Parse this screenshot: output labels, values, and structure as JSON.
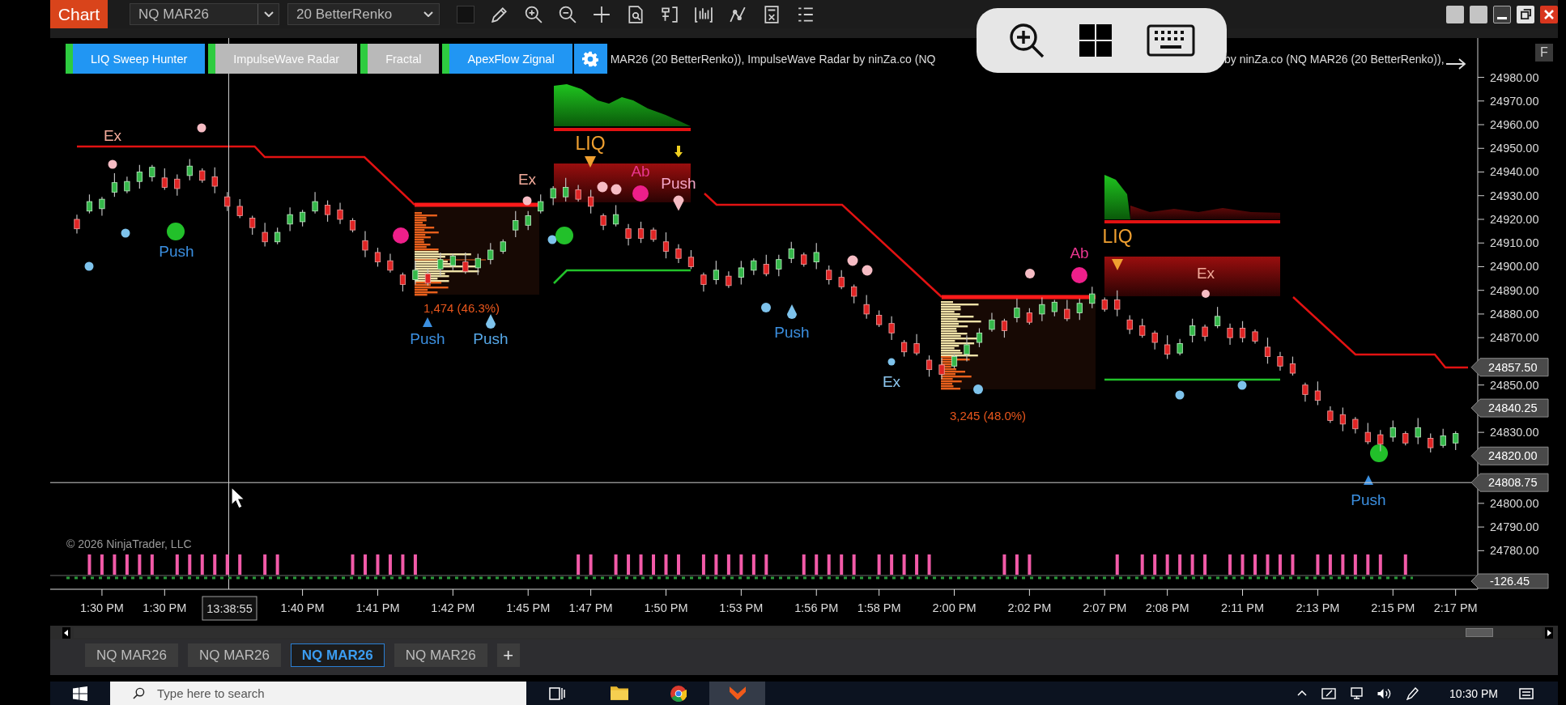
{
  "toolbar": {
    "title": "Chart",
    "instrument": "NQ MAR26",
    "interval": "20 BetterRenko"
  },
  "indicator_buttons": [
    {
      "label": "LIQ Sweep Hunter",
      "enabled": true
    },
    {
      "label": "ImpulseWave Radar",
      "enabled": false
    },
    {
      "label": "Fractal",
      "enabled": false
    },
    {
      "label": "ApexFlow Zignal",
      "enabled": true
    }
  ],
  "indicator_legend": [
    "MAR26 (20 BetterRenko)), ImpulseWave Radar by ninZa.co (NQ",
    "by ninZa.co (NQ MAR26 (20 BetterRenko)),"
  ],
  "side_button": "F",
  "chart": {
    "chart_data": {
      "type": "candlestick",
      "categories": [
        null,
        null,
        "1:30 PM",
        null,
        null,
        null,
        null,
        "1:30 PM",
        null,
        null,
        null,
        null,
        null,
        null,
        null,
        null,
        null,
        null,
        "1:40 PM",
        null,
        null,
        null,
        null,
        null,
        "1:41 PM",
        null,
        null,
        null,
        null,
        null,
        "1:42 PM",
        null,
        null,
        null,
        null,
        null,
        "1:45 PM",
        null,
        null,
        null,
        null,
        "1:47 PM",
        null,
        null,
        null,
        null,
        null,
        "1:50 PM",
        null,
        null,
        null,
        null,
        null,
        "1:53 PM",
        null,
        null,
        null,
        null,
        null,
        "1:56 PM",
        null,
        null,
        null,
        null,
        "1:58 PM",
        null,
        null,
        null,
        null,
        null,
        "2:00 PM",
        null,
        null,
        null,
        null,
        null,
        "2:02 PM",
        null,
        null,
        null,
        null,
        null,
        "2:07 PM",
        null,
        null,
        null,
        null,
        "2:08 PM",
        null,
        null,
        null,
        null,
        null,
        "2:11 PM",
        null,
        null,
        null,
        null,
        null,
        "2:13 PM",
        null,
        null,
        null,
        null,
        null,
        "2:15 PM",
        null,
        null,
        null,
        null,
        "2:17 PM"
      ],
      "ohlc": [
        [
          24920,
          24922,
          24914,
          24916
        ],
        [
          24923.5,
          24930.5,
          24922.5,
          24927.5
        ],
        [
          24924.5,
          24929.5,
          24921.5,
          24928.5
        ],
        [
          24931.5,
          24939.5,
          24929.5,
          24935.5
        ],
        [
          24932,
          24938,
          24931,
          24936
        ],
        [
          24936,
          24943,
          24933,
          24940
        ],
        [
          24938,
          24943,
          24936,
          24942
        ],
        [
          24937.5,
          24941.5,
          24932.5,
          24933.5
        ],
        [
          24937,
          24939,
          24930,
          24933
        ],
        [
          24938.5,
          24945.5,
          24936.5,
          24942.5
        ],
        [
          24940.5,
          24941.5,
          24935.5,
          24936.5
        ],
        [
          24938,
          24942,
          24931,
          24934
        ],
        [
          24929.5,
          24931.5,
          24923.5,
          24925.5
        ],
        [
          24925.5,
          24928.5,
          24920.5,
          24921.5
        ],
        [
          24920.5,
          24921.5,
          24913.5,
          24916.5
        ],
        [
          24914.5,
          24918.5,
          24908.5,
          24910.5
        ],
        [
          24910.5,
          24916.5,
          24909.5,
          24914.5
        ],
        [
          24918,
          24925,
          24915,
          24922
        ],
        [
          24919,
          24924,
          24917,
          24923
        ],
        [
          24923.5,
          24931.5,
          24922.5,
          24927.5
        ],
        [
          24926,
          24928,
          24919,
          24922
        ],
        [
          24924,
          24927,
          24918,
          24920
        ],
        [
          24919.5,
          24920.5,
          24914.5,
          24915.5
        ],
        [
          24911,
          24915,
          24904,
          24907
        ],
        [
          24906,
          24908,
          24900,
          24902
        ],
        [
          24902.5,
          24905.5,
          24897.5,
          24898.5
        ],
        [
          24896.5,
          24897.5,
          24889.5,
          24892.5
        ],
        [
          24894.5,
          24902.5,
          24892.5,
          24898.5
        ],
        [
          24897,
          24899,
          24892,
          24893
        ],
        [
          24899,
          24906,
          24896,
          24903
        ],
        [
          24900.5,
          24905.5,
          24898.5,
          24904.5
        ],
        [
          24902,
          24906,
          24897,
          24898
        ],
        [
          24899.5,
          24905.5,
          24896.5,
          24903.5
        ],
        [
          24903,
          24910,
          24901,
          24907
        ],
        [
          24906.5,
          24911.5,
          24905.5,
          24910.5
        ],
        [
          24915.5,
          24923.5,
          24912.5,
          24919.5
        ],
        [
          24917.5,
          24923.5,
          24915.5,
          24921.5
        ],
        [
          24923.5,
          24930.5,
          24922.5,
          24927.5
        ],
        [
          24929,
          24934,
          24926,
          24933
        ],
        [
          24929.5,
          24937.5,
          24927.5,
          24933.5
        ],
        [
          24932.5,
          24934.5,
          24927.5,
          24928.5
        ],
        [
          24929.5,
          24932.5,
          24922.5,
          24925.5
        ],
        [
          24921.5,
          24922.5,
          24915.5,
          24917.5
        ],
        [
          24918,
          24926,
          24917,
          24922
        ],
        [
          24916,
          24918,
          24909,
          24912
        ],
        [
          24916,
          24919,
          24910,
          24912
        ],
        [
          24915.5,
          24916.5,
          24910.5,
          24911.5
        ],
        [
          24910.5,
          24914.5,
          24903.5,
          24906.5
        ],
        [
          24907.5,
          24909.5,
          24901.5,
          24903.5
        ],
        [
          24904,
          24907,
          24899,
          24900
        ],
        [
          24896.5,
          24897.5,
          24889.5,
          24892.5
        ],
        [
          24894.5,
          24902.5,
          24892.5,
          24898.5
        ],
        [
          24896,
          24898,
          24891,
          24892
        ],
        [
          24895.5,
          24902.5,
          24892.5,
          24899.5
        ],
        [
          24898.5,
          24903.5,
          24896.5,
          24902.5
        ],
        [
          24901,
          24905,
          24896,
          24897
        ],
        [
          24899,
          24905,
          24896,
          24903
        ],
        [
          24903.5,
          24910.5,
          24901.5,
          24907.5
        ],
        [
          24905,
          24906,
          24900,
          24901
        ],
        [
          24902,
          24910,
          24899,
          24906
        ],
        [
          24898.5,
          24900.5,
          24892.5,
          24894.5
        ],
        [
          24895.5,
          24898.5,
          24890.5,
          24891.5
        ],
        [
          24891.5,
          24892.5,
          24884.5,
          24887.5
        ],
        [
          24884,
          24888,
          24878,
          24880
        ],
        [
          24879.5,
          24881.5,
          24874.5,
          24875.5
        ],
        [
          24876,
          24879,
          24869,
          24872
        ],
        [
          24868,
          24869,
          24862,
          24864
        ],
        [
          24867.5,
          24871.5,
          24862.5,
          24863.5
        ],
        [
          24860.5,
          24862.5,
          24853.5,
          24856.5
        ],
        [
          24858.5,
          24861.5,
          24852.5,
          24854.5
        ],
        [
          24858,
          24863,
          24857,
          24862
        ],
        [
          24863,
          24871,
          24860,
          24867
        ],
        [
          24868,
          24874,
          24866,
          24872
        ],
        [
          24873.5,
          24880.5,
          24872.5,
          24877.5
        ],
        [
          24877,
          24878,
          24870,
          24873
        ],
        [
          24878.5,
          24886.5,
          24876.5,
          24882.5
        ],
        [
          24880.5,
          24882.5,
          24875.5,
          24876.5
        ],
        [
          24880,
          24887,
          24877,
          24884
        ],
        [
          24881,
          24886,
          24879,
          24885
        ],
        [
          24882,
          24886,
          24877,
          24878
        ],
        [
          24880.5,
          24886.5,
          24877.5,
          24884.5
        ],
        [
          24884.5,
          24891.5,
          24882.5,
          24888.5
        ],
        [
          24886,
          24887,
          24881,
          24882
        ],
        [
          24886,
          24890,
          24879,
          24882
        ],
        [
          24877.5,
          24879.5,
          24871.5,
          24873.5
        ],
        [
          24875,
          24878,
          24870,
          24871
        ],
        [
          24872,
          24873,
          24865,
          24868
        ],
        [
          24867,
          24871,
          24861,
          24863
        ],
        [
          24863.5,
          24869.5,
          24862.5,
          24867.5
        ],
        [
          24871,
          24878,
          24868,
          24875
        ],
        [
          24874.5,
          24875.5,
          24868.5,
          24870.5
        ],
        [
          24875,
          24883,
          24874,
          24879
        ],
        [
          24874,
          24876,
          24867,
          24870
        ],
        [
          24874,
          24877,
          24868,
          24870
        ],
        [
          24872.5,
          24873.5,
          24867.5,
          24868.5
        ],
        [
          24866,
          24870,
          24859,
          24862
        ],
        [
          24862,
          24864,
          24856,
          24858
        ],
        [
          24859,
          24862,
          24854,
          24855
        ],
        [
          24850,
          24851,
          24843,
          24846
        ],
        [
          24847.5,
          24851.5,
          24841.5,
          24843.5
        ],
        [
          24839,
          24841,
          24834,
          24835
        ],
        [
          24837.5,
          24840.5,
          24830.5,
          24833.5
        ],
        [
          24835.5,
          24836.5,
          24829.5,
          24831.5
        ],
        [
          24830,
          24834,
          24825,
          24826
        ],
        [
          24829,
          24831,
          24822,
          24825
        ],
        [
          24828,
          24835,
          24826,
          24832
        ],
        [
          24829.5,
          24830.5,
          24824.5,
          24825.5
        ],
        [
          24828,
          24836,
          24825,
          24832
        ],
        [
          24827.5,
          24829.5,
          24821.5,
          24823.5
        ],
        [
          24824.5,
          24831.5,
          24823.5,
          24828.5
        ],
        [
          24825.5,
          24830.5,
          24822.5,
          24829.5
        ]
      ],
      "ylim": [
        24763.7,
        24996.6
      ],
      "yticks": [
        {
          "value": 24980,
          "label": "24980.00"
        },
        {
          "value": 24970,
          "label": "24970.00"
        },
        {
          "value": 24960,
          "label": "24960.00"
        },
        {
          "value": 24950,
          "label": "24950.00"
        },
        {
          "value": 24940,
          "label": "24940.00"
        },
        {
          "value": 24930,
          "label": "24930.00"
        },
        {
          "value": 24920,
          "label": "24920.00"
        },
        {
          "value": 24910,
          "label": "24910.00"
        },
        {
          "value": 24900,
          "label": "24900.00"
        },
        {
          "value": 24890,
          "label": "24890.00"
        },
        {
          "value": 24880,
          "label": "24880.00"
        },
        {
          "value": 24870,
          "label": "24870.00"
        },
        {
          "value": 24850,
          "label": "24850.00"
        },
        {
          "value": 24830,
          "label": "24830.00"
        },
        {
          "value": 24800,
          "label": "24800.00"
        },
        {
          "value": 24790,
          "label": "24790.00"
        },
        {
          "value": 24780,
          "label": "24780.00"
        }
      ]
    }
  },
  "chart_labels": [
    {
      "text": "Ex",
      "color": "#f2aa9a"
    },
    {
      "text": "Push",
      "color": "#3b8fe0"
    },
    {
      "text": "Push",
      "color": "#3b8fe0"
    },
    {
      "text": "1,474 (46.3%)",
      "color": "#e8561c"
    },
    {
      "text": "Push",
      "color": "#56a8e8"
    },
    {
      "text": "Ex",
      "color": "#f2aa9a"
    },
    {
      "text": "LIQ",
      "color": "#f0a030"
    },
    {
      "text": "Ab",
      "color": "#e8368f"
    },
    {
      "text": "Push",
      "color": "#f4a6c8"
    },
    {
      "text": "Push",
      "color": "#3b8fe0"
    },
    {
      "text": "Ex",
      "color": "#8cc6ee"
    },
    {
      "text": "3,245 (48.0%)",
      "color": "#e8561c"
    },
    {
      "text": "Ab",
      "color": "#e8368f"
    },
    {
      "text": "LIQ",
      "color": "#f0a030"
    },
    {
      "text": "Ex",
      "color": "#f2aa9a"
    },
    {
      "text": "Push",
      "color": "#3b8fe0"
    }
  ],
  "copyright": "© 2026 NinjaTrader, LLC",
  "price_axis": {
    "markers": [
      "24857.50",
      "24840.25",
      "24820.00",
      "24808.75"
    ],
    "panel_value": "-126.45"
  },
  "time_axis": {
    "cursor_time": "13:38:55"
  },
  "tabs": [
    {
      "label": "NQ MAR26",
      "selected": false
    },
    {
      "label": "NQ MAR26",
      "selected": false
    },
    {
      "label": "NQ MAR26",
      "selected": true
    },
    {
      "label": "NQ MAR26",
      "selected": false
    }
  ],
  "add_tab": "+",
  "taskbar": {
    "search": {
      "placeholder": "Type here to search"
    },
    "clock": "10:30 PM"
  }
}
